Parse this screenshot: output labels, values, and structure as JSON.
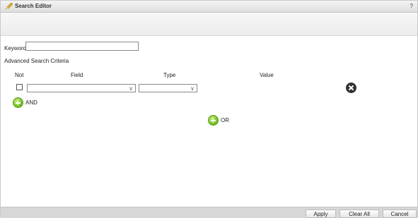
{
  "window": {
    "title": "Search Editor",
    "help_label": "?"
  },
  "keyword": {
    "label": "Keyword",
    "value": ""
  },
  "advanced": {
    "title": "Advanced Search Criteria",
    "columns": {
      "not": "Not",
      "field": "Field",
      "type": "Type",
      "value": "Value"
    },
    "row": {
      "not_checked": false,
      "field_value": "",
      "type_value": ""
    }
  },
  "and_label": "AND",
  "or_label": "OR",
  "footer": {
    "apply": "Apply",
    "clear_all": "Clear All",
    "cancel": "Cancel"
  },
  "colors": {
    "add_green": "#6aba1c",
    "remove_dark": "#333333",
    "footer_bg": "#d7d7d7"
  },
  "icons": {
    "title": "pencil-icon",
    "add": "plus-circle-icon",
    "remove": "close-circle-icon"
  }
}
